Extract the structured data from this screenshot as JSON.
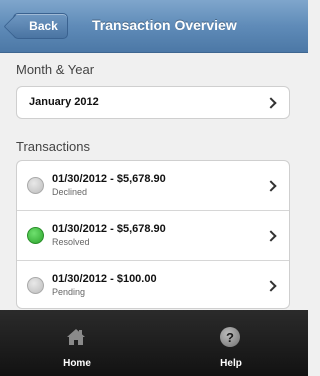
{
  "header": {
    "back_label": "Back",
    "title": "Transaction Overview"
  },
  "month_section": {
    "label": "Month & Year",
    "value": "January 2012"
  },
  "transactions_section": {
    "label": "Transactions",
    "items": [
      {
        "summary": "01/30/2012 - $5,678.90",
        "status": "Declined",
        "indicator": "gray"
      },
      {
        "summary": "01/30/2012 - $5,678.90",
        "status": "Resolved",
        "indicator": "green"
      },
      {
        "summary": "01/30/2012 - $100.00",
        "status": "Pending",
        "indicator": "gray"
      }
    ]
  },
  "footer": {
    "tabs": [
      {
        "label": "Home",
        "icon": "home-icon"
      },
      {
        "label": "Help",
        "icon": "help-icon",
        "glyph": "?"
      }
    ]
  },
  "colors": {
    "header": "#5f8bb8",
    "resolved": "#2ea52e",
    "footer": "#1a1a1a"
  }
}
